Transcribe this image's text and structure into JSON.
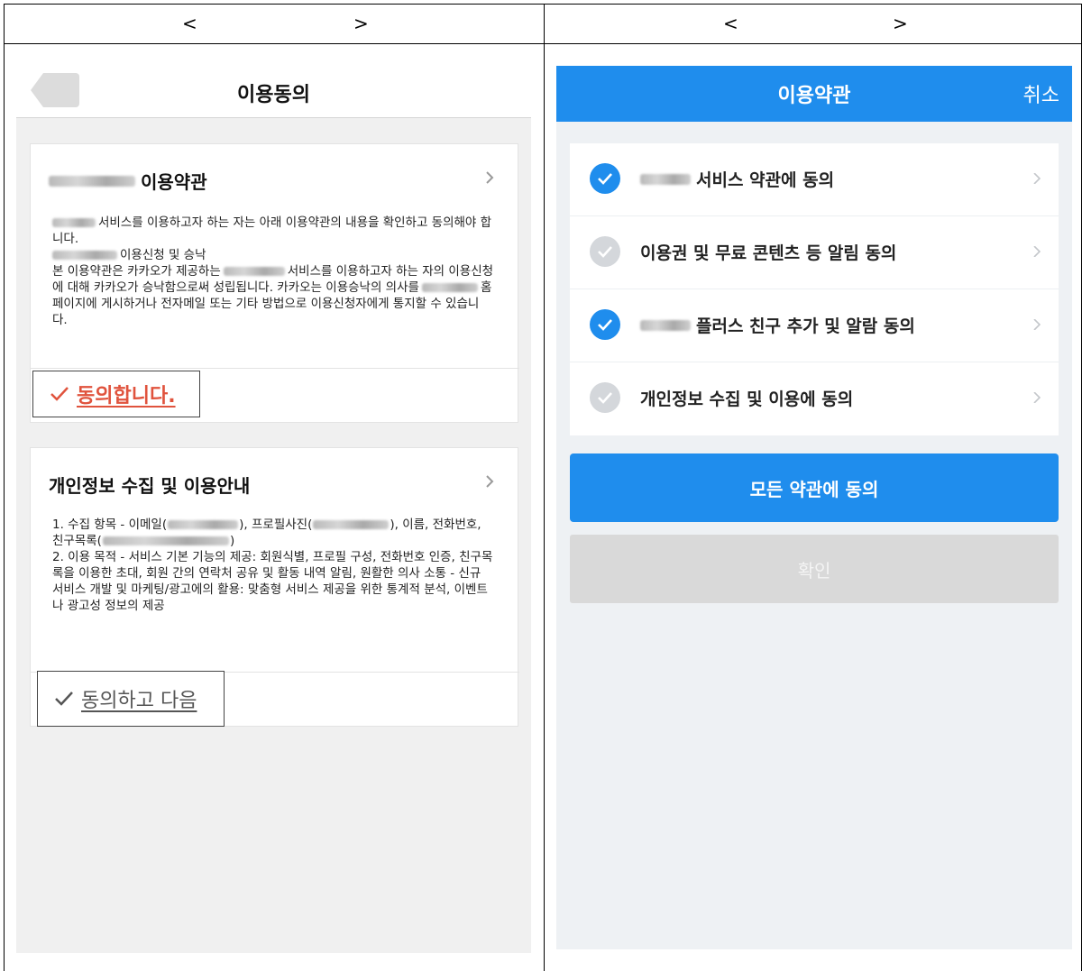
{
  "comparison": {
    "left_prev": "<",
    "left_next": ">",
    "right_prev": "<",
    "right_next": ">"
  },
  "left": {
    "title": "이용동의",
    "terms_card": {
      "title": "이용약관",
      "body": [
        "서비스를 이용하고자 하는 자는 아래 이용약관의 내용을 확인하고 동의해야 합니다.",
        "이용신청 및 승낙",
        "본 이용약관은 카카오가 제공하는",
        "서비스를 이용하고자 하는 자의 이용신청에 대해 카카오가 승낙함으로써 성립됩니다. 카카오는 이용승낙의 의사를",
        "홈페이지에 게시하거나 전자메일 또는 기타 방법으로 이용신청자에게 통지할 수 있습니다."
      ],
      "agree_label": "동의합니다."
    },
    "privacy_card": {
      "title": "개인정보 수집 및 이용안내",
      "body_1a": "1. 수집 항목 - 이메일(",
      "body_1b": "), 프로필사진(",
      "body_1c": "), 이름, 전화번호, 친구목록(",
      "body_1d": ")",
      "body_2": "2. 이용 목적 - 서비스 기본 기능의 제공: 회원식별, 프로필 구성, 전화번호 인증, 친구목록을 이용한 초대, 회원 간의 연락처 공유 및 활동 내역 알림, 원활한 의사 소통 - 신규 서비스 개발 및 마케팅/광고에의 활용: 맞춤형 서비스 제공을 위한 통계적 분석, 이벤트나 광고성 정보의 제공",
      "agree_label": "동의하고 다음"
    }
  },
  "right": {
    "title": "이용약관",
    "cancel_label": "취소",
    "items": [
      {
        "label": "서비스 약관에 동의",
        "checked": true,
        "blurred_prefix": true
      },
      {
        "label": "이용권 및 무료 콘텐츠 등 알림 동의",
        "checked": false,
        "blurred_prefix": false
      },
      {
        "label": "플러스 친구 추가 및 알람 동의",
        "checked": true,
        "blurred_prefix": true
      },
      {
        "label": "개인정보 수집 및 이용에 동의",
        "checked": false,
        "blurred_prefix": false
      }
    ],
    "agree_all_label": "모든 약관에 동의",
    "confirm_label": "확인"
  },
  "colors": {
    "kakao_blue": "#1f8ded",
    "agree_red": "#e0533d",
    "check_off": "#d4d7db",
    "disabled_btn": "#d9d9d9"
  },
  "icons": [
    "back-icon",
    "chevron-right-icon",
    "check-icon",
    "check-circle-icon"
  ]
}
